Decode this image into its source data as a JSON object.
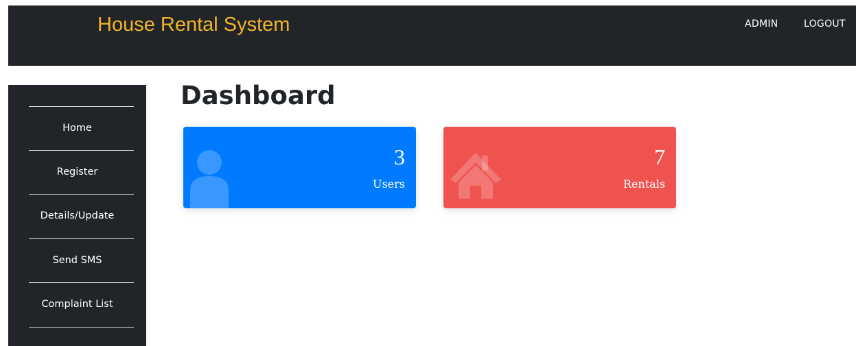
{
  "header": {
    "brand": "House Rental System",
    "brand_color": "#f0b429",
    "nav": [
      {
        "label": "ADMIN"
      },
      {
        "label": "LOGOUT"
      }
    ]
  },
  "sidebar": {
    "items": [
      {
        "label": "Home"
      },
      {
        "label": "Register"
      },
      {
        "label": "Details/Update"
      },
      {
        "label": "Send SMS"
      },
      {
        "label": "Complaint List"
      }
    ]
  },
  "main": {
    "title": "Dashboard",
    "cards": [
      {
        "count": "3",
        "label": "Users",
        "icon": "user-icon",
        "color": "#007bff"
      },
      {
        "count": "7",
        "label": "Rentals",
        "icon": "house-icon",
        "color": "#ef5350"
      }
    ]
  }
}
